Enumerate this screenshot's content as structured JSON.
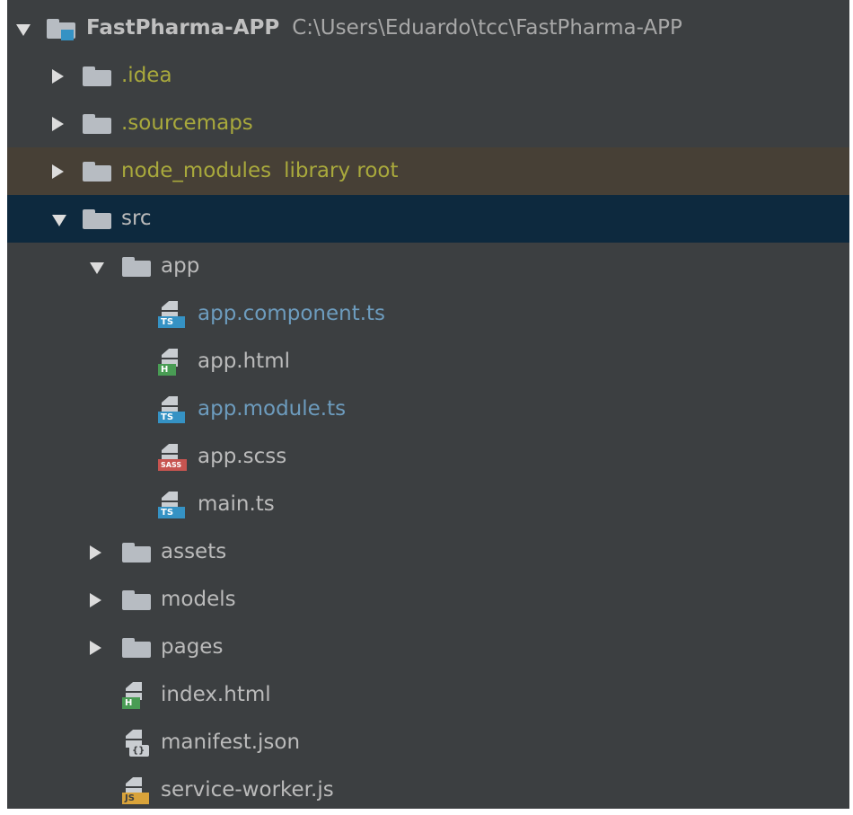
{
  "project": {
    "name": "FastPharma-APP",
    "path": "C:\\Users\\Eduardo\\tcc\\FastPharma-APP"
  },
  "tree": {
    "idea": ".idea",
    "sourcemaps": ".sourcemaps",
    "node_modules": "node_modules",
    "library_root": "library root",
    "src": "src",
    "app": "app",
    "app_component": "app.component.ts",
    "app_html": "app.html",
    "app_module": "app.module.ts",
    "app_scss": "app.scss",
    "main_ts": "main.ts",
    "assets": "assets",
    "models": "models",
    "pages": "pages",
    "index_html": "index.html",
    "manifest": "manifest.json",
    "service_worker": "service-worker.js"
  },
  "badges": {
    "ts": "TS",
    "h": "H",
    "sass": "SASS",
    "js": "JS",
    "json": "{}"
  },
  "colors": {
    "panel_bg": "#3c3f41",
    "selected_bg": "#0d293e",
    "library_bg": "#474036",
    "ignored_text": "#a9a93c",
    "modified_text": "#6d9cbe"
  }
}
